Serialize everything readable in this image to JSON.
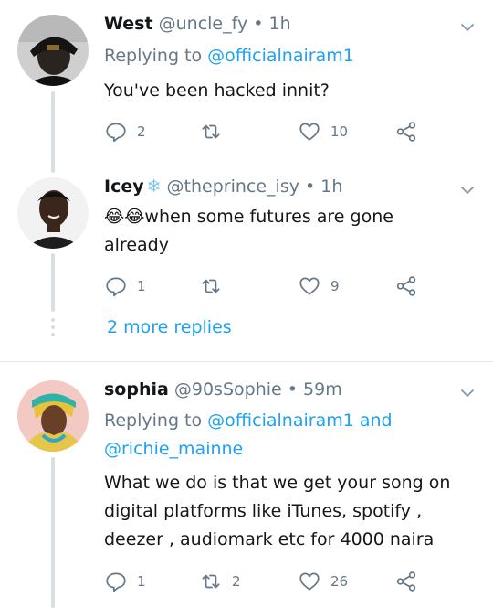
{
  "tweets": [
    {
      "name": "West",
      "handle": "@uncle_fy",
      "sep": " • ",
      "time": "1h",
      "replying_prefix": "Replying to ",
      "replying_to": "@officialnairam1",
      "text": "You've been hacked innit?",
      "actions": {
        "reply": "2",
        "retweet": "",
        "like": "10"
      }
    },
    {
      "name": "Icey",
      "name_emoji": "❄",
      "handle": "@theprince_isy",
      "sep": " • ",
      "time": "1h",
      "emoji": "😂😂",
      "text": "when some futures are gone already",
      "actions": {
        "reply": "1",
        "retweet": "",
        "like": "9"
      }
    },
    {
      "name": "sophia",
      "handle": "@90sSophie",
      "sep": " • ",
      "time": "59m",
      "replying_prefix": "Replying to ",
      "replying_to": "@officialnairam1",
      "replying_and": " and",
      "replying_to_2": "@richie_mainne",
      "text": "What we do is that we get your song on digital platforms like iTunes, spotify , deezer , audiomark etc for 4000 naira",
      "actions": {
        "reply": "1",
        "retweet": "2",
        "like": "26"
      }
    }
  ],
  "more_replies": "2 more replies",
  "colors": {
    "accent": "#1da1f2",
    "muted": "#657786",
    "line": "#d9dee2"
  }
}
